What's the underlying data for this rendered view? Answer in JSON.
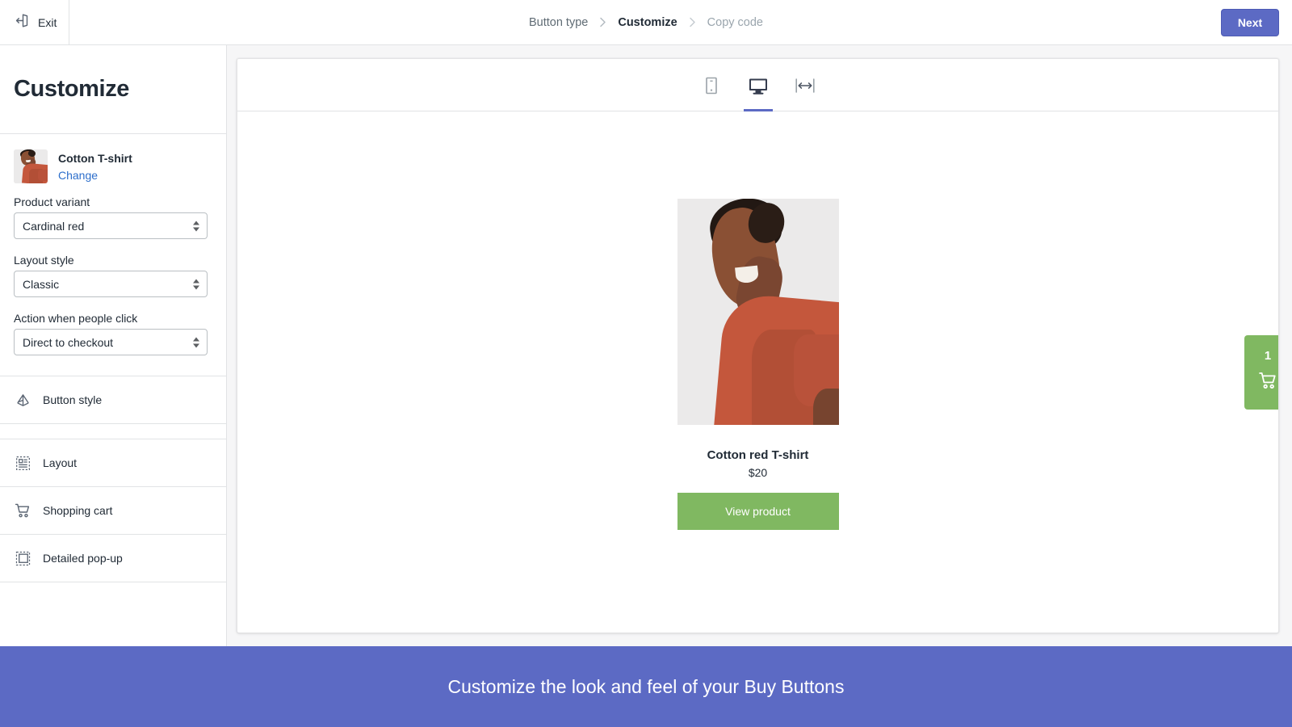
{
  "topbar": {
    "exit_label": "Exit",
    "exit_icon": "exit-door-icon",
    "next_label": "Next",
    "breadcrumbs": [
      {
        "label": "Button type",
        "state": "done"
      },
      {
        "label": "Customize",
        "state": "active"
      },
      {
        "label": "Copy code",
        "state": "upcoming"
      }
    ],
    "separator": "›"
  },
  "sidebar": {
    "title": "Customize",
    "product": {
      "name": "Cotton T-shirt",
      "change_label": "Change",
      "thumbnail_alt": "cotton-t-shirt-thumbnail"
    },
    "fields": [
      {
        "label": "Product variant",
        "value": "Cardinal red",
        "name": "product-variant-select"
      },
      {
        "label": "Layout style",
        "value": "Classic",
        "name": "layout-style-select"
      },
      {
        "label": "Action when people click",
        "value": "Direct to checkout",
        "name": "click-action-select"
      }
    ],
    "menu": [
      {
        "label": "Button style",
        "icon": "button-style-icon"
      },
      {
        "label": "Layout",
        "icon": "layout-icon"
      },
      {
        "label": "Shopping cart",
        "icon": "shopping-cart-icon"
      },
      {
        "label": "Detailed pop-up",
        "icon": "popup-icon"
      }
    ]
  },
  "preview": {
    "devices": [
      {
        "name": "mobile",
        "icon": "mobile-device-icon",
        "active": false
      },
      {
        "name": "desktop",
        "icon": "desktop-device-icon",
        "active": true
      },
      {
        "name": "full-width",
        "icon": "full-width-icon",
        "active": false
      }
    ],
    "product": {
      "title": "Cotton red T-shirt",
      "price": "$20",
      "button_label": "View product",
      "image_alt": "woman-wearing-cardinal-red-t-shirt"
    },
    "cart": {
      "count": "1",
      "icon": "shopping-cart-icon"
    }
  },
  "banner": {
    "text": "Customize the look and feel of your Buy Buttons"
  },
  "colors": {
    "accent": "#5c6ac4",
    "button_green": "#80b861",
    "link_blue": "#2c6ecb",
    "border": "#e1e3e5",
    "text": "#212b36",
    "muted_text": "#9aa5ad"
  }
}
